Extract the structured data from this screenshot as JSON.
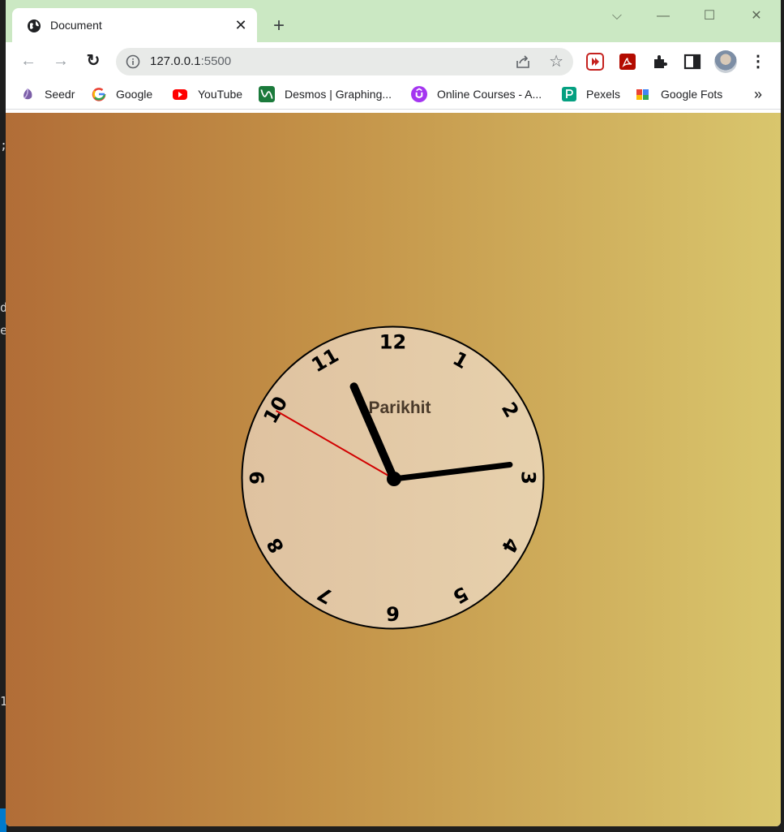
{
  "browser": {
    "tab": {
      "title": "Document",
      "close_glyph": "✕",
      "icon": "globe-icon"
    },
    "new_tab_glyph": "+",
    "window_controls": {
      "dropdown": "⌵",
      "minimize": "—",
      "maximize": "☐",
      "close": "✕"
    },
    "nav": {
      "back": "←",
      "forward": "→",
      "reload": "↻"
    },
    "address": {
      "host": "127.0.0.1",
      "port": ":5500"
    },
    "star_glyph": "☆",
    "menu_glyph": "⋮",
    "bookmarks": [
      {
        "label": "Seedr",
        "icon": "seedr-icon",
        "color": "#7b5ea7"
      },
      {
        "label": "Google",
        "icon": "google-icon",
        "color": "#4285f4"
      },
      {
        "label": "YouTube",
        "icon": "youtube-icon",
        "color": "#ff0000"
      },
      {
        "label": "Desmos | Graphing...",
        "icon": "desmos-icon",
        "color": "#1b7a3b"
      },
      {
        "label": "Online Courses - A...",
        "icon": "udemy-icon",
        "color": "#a435f0"
      },
      {
        "label": "Pexels",
        "icon": "pexels-icon",
        "color": "#05a081"
      },
      {
        "label": "Google Fots",
        "icon": "google-photos-icon",
        "color": "#fbbc04"
      }
    ],
    "bookmarks_more": "»"
  },
  "clock": {
    "brand": "Parikhit",
    "numbers": [
      "12",
      "1",
      "2",
      "3",
      "4",
      "5",
      "6",
      "7",
      "8",
      "9",
      "10",
      "11"
    ],
    "time": {
      "hour": 11,
      "minute": 13,
      "second": 50
    },
    "colors": {
      "face": "#e3c7a4",
      "border": "#000000",
      "hands": "#000000",
      "second_hand": "#d10000"
    }
  },
  "page_colors": {
    "gradient_start": "#b16d37",
    "gradient_end": "#d9c66d"
  }
}
